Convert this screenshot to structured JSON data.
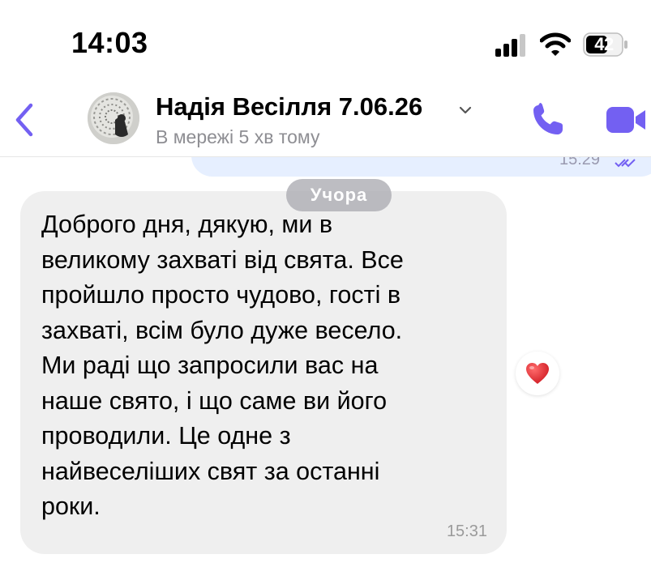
{
  "status_bar": {
    "time": "14:03",
    "battery_level": "42"
  },
  "header": {
    "contact_name": "Надія Весілля 7.06.26",
    "contact_status": "В мережі 5 хв тому",
    "icons": [
      "back-icon",
      "avatar",
      "chevron-down-icon",
      "phone-icon",
      "video-camera-icon"
    ],
    "accent_color": "#7360f2"
  },
  "conversation": {
    "previous_outgoing": {
      "time": "15:29",
      "status_icon": "read-ticks-icon"
    },
    "date_separator": "Учора",
    "incoming_message": {
      "text": "Доброго дня, дякую, ми в\nвеликому захваті від свята. Все\nпройшло просто чудово, гості в\nзахваті, всім було дуже весело.\nМи раді що запросили вас на\nнаше свято, і що саме ви його\nпроводили. Це одне з\nнайвеселіших свят за останні\nроки.",
      "time": "15:31",
      "reaction_icon": "heart-icon"
    }
  },
  "colors": {
    "outgoing_bubble": "#e6efff",
    "incoming_bubble": "#efefef",
    "heart": "#e0242b"
  }
}
